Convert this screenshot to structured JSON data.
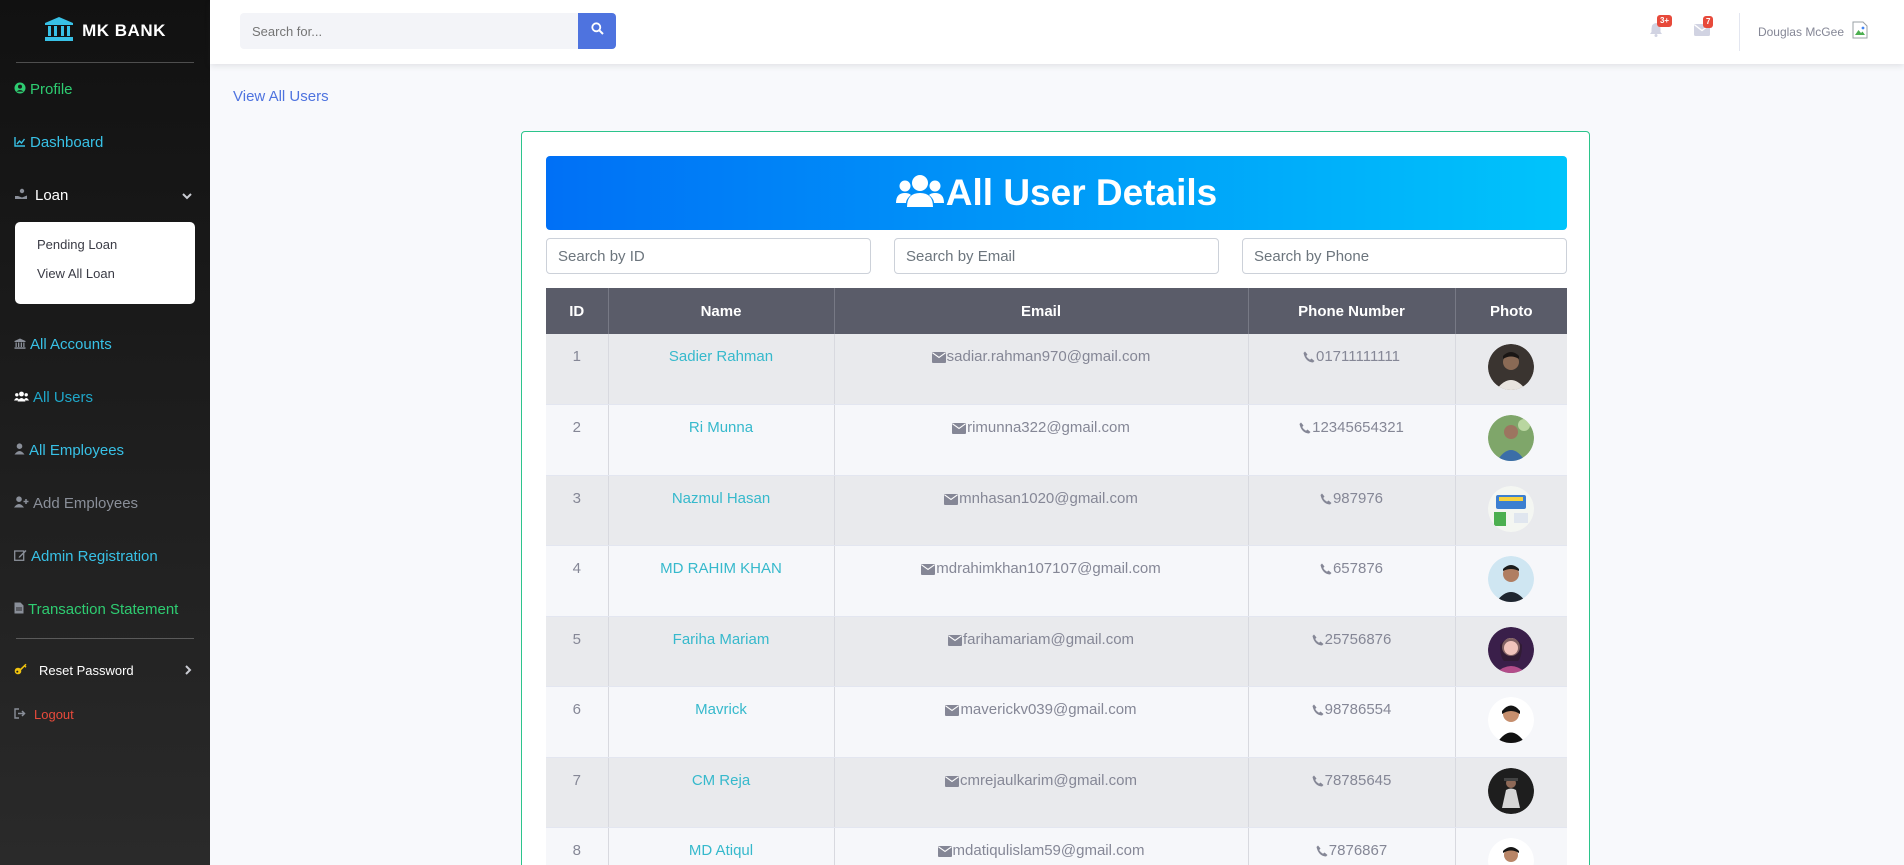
{
  "brand": {
    "name": "MK BANK"
  },
  "sidebar": {
    "items": [
      {
        "label": "Profile",
        "icon": "user-circle-icon",
        "color": "#2ecc71"
      },
      {
        "label": "Dashboard",
        "icon": "chart-line-icon",
        "color": "#38c1e6"
      },
      {
        "label": "Loan",
        "icon": "hand-holding-icon",
        "color": "#ffffff"
      },
      {
        "label": "All Accounts",
        "icon": "bank-icon",
        "color": "#38c1e6"
      },
      {
        "label": "All Users",
        "icon": "users-icon",
        "color": "#1fa7c9"
      },
      {
        "label": "All Employees",
        "icon": "user-icon",
        "color": "#38c1e6"
      },
      {
        "label": "Add Employees",
        "icon": "user-plus-icon",
        "color": "#8a8f99"
      },
      {
        "label": "Admin Registration",
        "icon": "edit-icon",
        "color": "#38c1e6"
      },
      {
        "label": "Transaction Statement",
        "icon": "file-icon",
        "color": "#2ecc71"
      },
      {
        "label": "Reset Password",
        "icon": "key-icon",
        "color": "#ffffff"
      },
      {
        "label": "Logout",
        "icon": "sign-out-icon",
        "color": "#e74a3b"
      }
    ],
    "loan_submenu": [
      "Pending Loan",
      "View All Loan"
    ]
  },
  "topbar": {
    "search_placeholder": "Search for...",
    "alerts_badge": "3+",
    "messages_badge": "7",
    "user_name": "Douglas McGee"
  },
  "page": {
    "breadcrumb": "View All Users",
    "title": "All User Details",
    "filters": {
      "id_placeholder": "Search by ID",
      "email_placeholder": "Search by Email",
      "phone_placeholder": "Search by Phone"
    },
    "table": {
      "headers": [
        "ID",
        "Name",
        "Email",
        "Phone Number",
        "Photo"
      ],
      "rows": [
        {
          "id": "1",
          "name": "Sadier Rahman",
          "email": "sadiar.rahman970@gmail.com",
          "phone": "01711111111"
        },
        {
          "id": "2",
          "name": "Ri Munna",
          "email": "rimunna322@gmail.com",
          "phone": "12345654321"
        },
        {
          "id": "3",
          "name": "Nazmul Hasan",
          "email": "mnhasan1020@gmail.com",
          "phone": "987976"
        },
        {
          "id": "4",
          "name": "MD RAHIM KHAN",
          "email": "mdrahimkhan107107@gmail.com",
          "phone": "657876"
        },
        {
          "id": "5",
          "name": "Fariha Mariam",
          "email": "farihamariam@gmail.com",
          "phone": "25756876"
        },
        {
          "id": "6",
          "name": "Mavrick",
          "email": "maverickv039@gmail.com",
          "phone": "98786554"
        },
        {
          "id": "7",
          "name": "CM Reja",
          "email": "cmrejaulkarim@gmail.com",
          "phone": "78785645"
        },
        {
          "id": "8",
          "name": "MD Atiqul",
          "email": "mdatiqulislam59@gmail.com",
          "phone": "7876867"
        }
      ]
    }
  },
  "colors": {
    "sidebar_bg": "#111111",
    "primary": "#4e73df",
    "banner_start": "#0070f6",
    "banner_end": "#00c4fb",
    "table_header": "#5a5c69",
    "name_link": "#36b9cc",
    "card_border": "#2bc48b"
  }
}
